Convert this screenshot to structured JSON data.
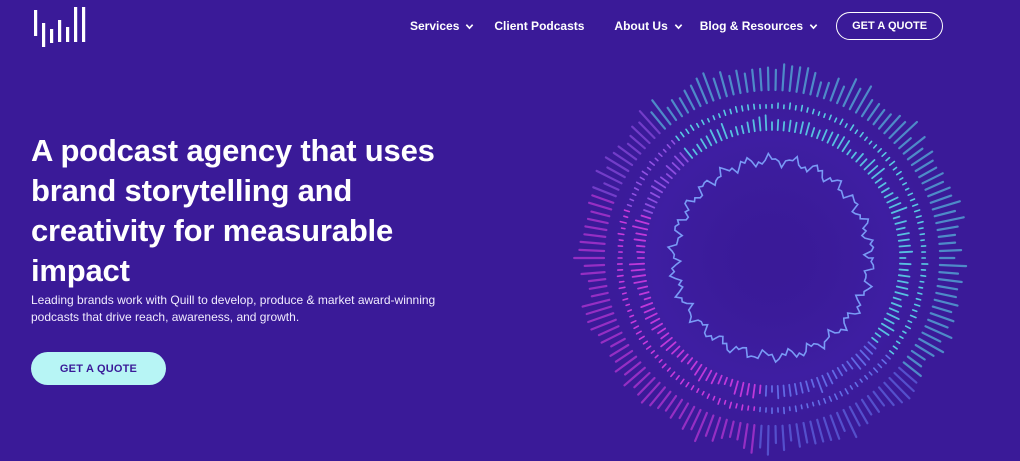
{
  "header": {
    "logo_icon": "quill-bars-logo",
    "nav": {
      "services": "Services",
      "client_podcasts": "Client Podcasts",
      "about_us": "About Us",
      "blog_resources": "Blog & Resources"
    },
    "cta": "GET A QUOTE"
  },
  "hero": {
    "title": "A podcast agency that uses brand storytelling and creativity for measurable impact",
    "subtitle": "Leading brands work with Quill to develop, produce & market award-winning podcasts that drive reach, awareness, and growth.",
    "cta": "GET A QUOTE"
  },
  "colors": {
    "background": "#3a1a98",
    "accent_cyan": "#b7f5f5",
    "ring_cyan": "#5ee8f0",
    "ring_magenta": "#e040e8",
    "ring_blue": "#6a7cf5"
  }
}
